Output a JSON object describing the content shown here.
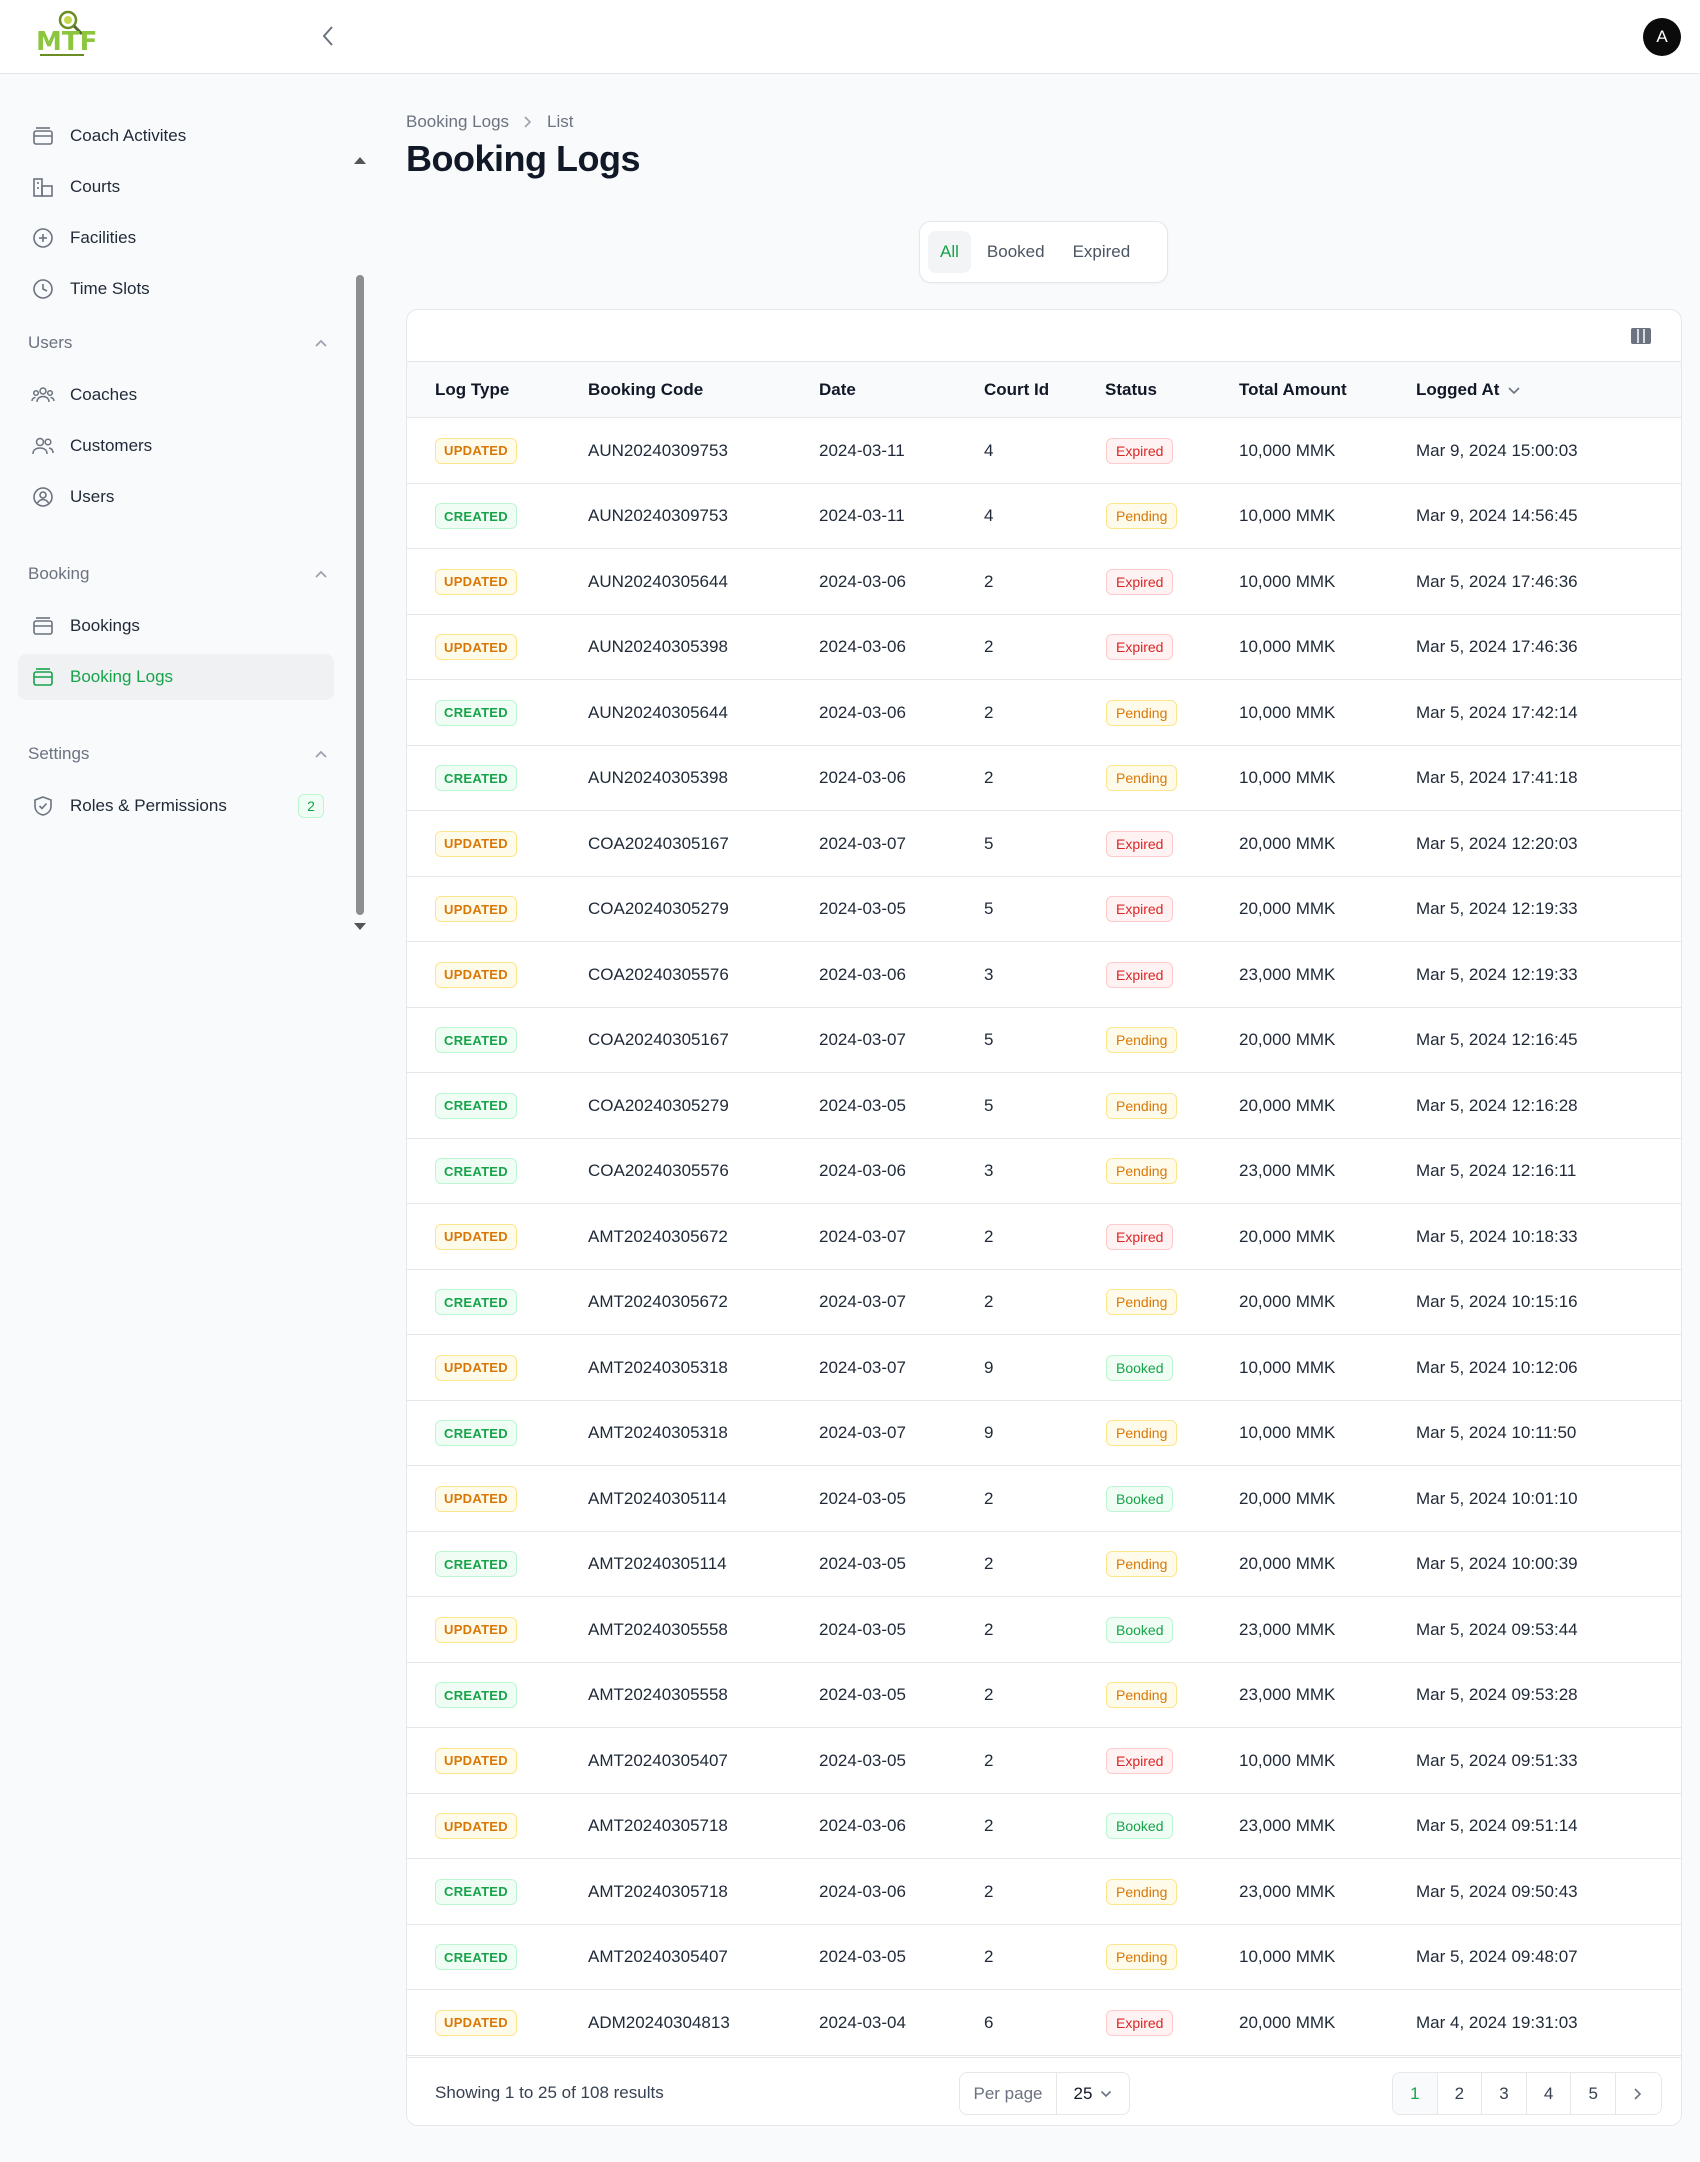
{
  "app": {
    "logo_text": "MTF",
    "avatar_initial": "A"
  },
  "sidebar": {
    "top_items": [
      {
        "label": "Coach Activites",
        "icon": "coach-activities-icon"
      },
      {
        "label": "Courts",
        "icon": "courts-icon"
      },
      {
        "label": "Facilities",
        "icon": "facilities-icon"
      },
      {
        "label": "Time Slots",
        "icon": "clock-icon"
      }
    ],
    "groups": [
      {
        "label": "Users",
        "items": [
          {
            "label": "Coaches"
          },
          {
            "label": "Customers"
          },
          {
            "label": "Users"
          }
        ]
      },
      {
        "label": "Booking",
        "items": [
          {
            "label": "Bookings"
          },
          {
            "label": "Booking Logs",
            "active": true
          }
        ]
      },
      {
        "label": "Settings",
        "items": [
          {
            "label": "Roles & Permissions",
            "badge": "2"
          }
        ]
      }
    ]
  },
  "breadcrumb": {
    "parent": "Booking Logs",
    "current": "List"
  },
  "page": {
    "title": "Booking Logs"
  },
  "tabs": [
    {
      "label": "All",
      "active": true
    },
    {
      "label": "Booked"
    },
    {
      "label": "Expired"
    }
  ],
  "table": {
    "columns": [
      "Log Type",
      "Booking Code",
      "Date",
      "Court Id",
      "Status",
      "Total Amount",
      "Logged At"
    ],
    "sorted_column": "Logged At",
    "rows": [
      [
        "UPDATED",
        "AUN20240309753",
        "2024-03-11",
        "4",
        "Expired",
        "10,000 MMK",
        "Mar 9, 2024 15:00:03"
      ],
      [
        "CREATED",
        "AUN20240309753",
        "2024-03-11",
        "4",
        "Pending",
        "10,000 MMK",
        "Mar 9, 2024 14:56:45"
      ],
      [
        "UPDATED",
        "AUN20240305644",
        "2024-03-06",
        "2",
        "Expired",
        "10,000 MMK",
        "Mar 5, 2024 17:46:36"
      ],
      [
        "UPDATED",
        "AUN20240305398",
        "2024-03-06",
        "2",
        "Expired",
        "10,000 MMK",
        "Mar 5, 2024 17:46:36"
      ],
      [
        "CREATED",
        "AUN20240305644",
        "2024-03-06",
        "2",
        "Pending",
        "10,000 MMK",
        "Mar 5, 2024 17:42:14"
      ],
      [
        "CREATED",
        "AUN20240305398",
        "2024-03-06",
        "2",
        "Pending",
        "10,000 MMK",
        "Mar 5, 2024 17:41:18"
      ],
      [
        "UPDATED",
        "COA20240305167",
        "2024-03-07",
        "5",
        "Expired",
        "20,000 MMK",
        "Mar 5, 2024 12:20:03"
      ],
      [
        "UPDATED",
        "COA20240305279",
        "2024-03-05",
        "5",
        "Expired",
        "20,000 MMK",
        "Mar 5, 2024 12:19:33"
      ],
      [
        "UPDATED",
        "COA20240305576",
        "2024-03-06",
        "3",
        "Expired",
        "23,000 MMK",
        "Mar 5, 2024 12:19:33"
      ],
      [
        "CREATED",
        "COA20240305167",
        "2024-03-07",
        "5",
        "Pending",
        "20,000 MMK",
        "Mar 5, 2024 12:16:45"
      ],
      [
        "CREATED",
        "COA20240305279",
        "2024-03-05",
        "5",
        "Pending",
        "20,000 MMK",
        "Mar 5, 2024 12:16:28"
      ],
      [
        "CREATED",
        "COA20240305576",
        "2024-03-06",
        "3",
        "Pending",
        "23,000 MMK",
        "Mar 5, 2024 12:16:11"
      ],
      [
        "UPDATED",
        "AMT20240305672",
        "2024-03-07",
        "2",
        "Expired",
        "20,000 MMK",
        "Mar 5, 2024 10:18:33"
      ],
      [
        "CREATED",
        "AMT20240305672",
        "2024-03-07",
        "2",
        "Pending",
        "20,000 MMK",
        "Mar 5, 2024 10:15:16"
      ],
      [
        "UPDATED",
        "AMT20240305318",
        "2024-03-07",
        "9",
        "Booked",
        "10,000 MMK",
        "Mar 5, 2024 10:12:06"
      ],
      [
        "CREATED",
        "AMT20240305318",
        "2024-03-07",
        "9",
        "Pending",
        "10,000 MMK",
        "Mar 5, 2024 10:11:50"
      ],
      [
        "UPDATED",
        "AMT20240305114",
        "2024-03-05",
        "2",
        "Booked",
        "20,000 MMK",
        "Mar 5, 2024 10:01:10"
      ],
      [
        "CREATED",
        "AMT20240305114",
        "2024-03-05",
        "2",
        "Pending",
        "20,000 MMK",
        "Mar 5, 2024 10:00:39"
      ],
      [
        "UPDATED",
        "AMT20240305558",
        "2024-03-05",
        "2",
        "Booked",
        "23,000 MMK",
        "Mar 5, 2024 09:53:44"
      ],
      [
        "CREATED",
        "AMT20240305558",
        "2024-03-05",
        "2",
        "Pending",
        "23,000 MMK",
        "Mar 5, 2024 09:53:28"
      ],
      [
        "UPDATED",
        "AMT20240305407",
        "2024-03-05",
        "2",
        "Expired",
        "10,000 MMK",
        "Mar 5, 2024 09:51:33"
      ],
      [
        "UPDATED",
        "AMT20240305718",
        "2024-03-06",
        "2",
        "Booked",
        "23,000 MMK",
        "Mar 5, 2024 09:51:14"
      ],
      [
        "CREATED",
        "AMT20240305718",
        "2024-03-06",
        "2",
        "Pending",
        "23,000 MMK",
        "Mar 5, 2024 09:50:43"
      ],
      [
        "CREATED",
        "AMT20240305407",
        "2024-03-05",
        "2",
        "Pending",
        "10,000 MMK",
        "Mar 5, 2024 09:48:07"
      ],
      [
        "UPDATED",
        "ADM20240304813",
        "2024-03-04",
        "6",
        "Expired",
        "20,000 MMK",
        "Mar 4, 2024 19:31:03"
      ]
    ]
  },
  "footer": {
    "showing_text": "Showing 1 to 25 of 108 results",
    "per_page_label": "Per page",
    "per_page_value": "25",
    "pages": [
      "1",
      "2",
      "3",
      "4",
      "5"
    ],
    "current_page": "1"
  },
  "colors": {
    "accent": "#16a34a",
    "warning": "#d97706",
    "danger": "#dc2626"
  }
}
